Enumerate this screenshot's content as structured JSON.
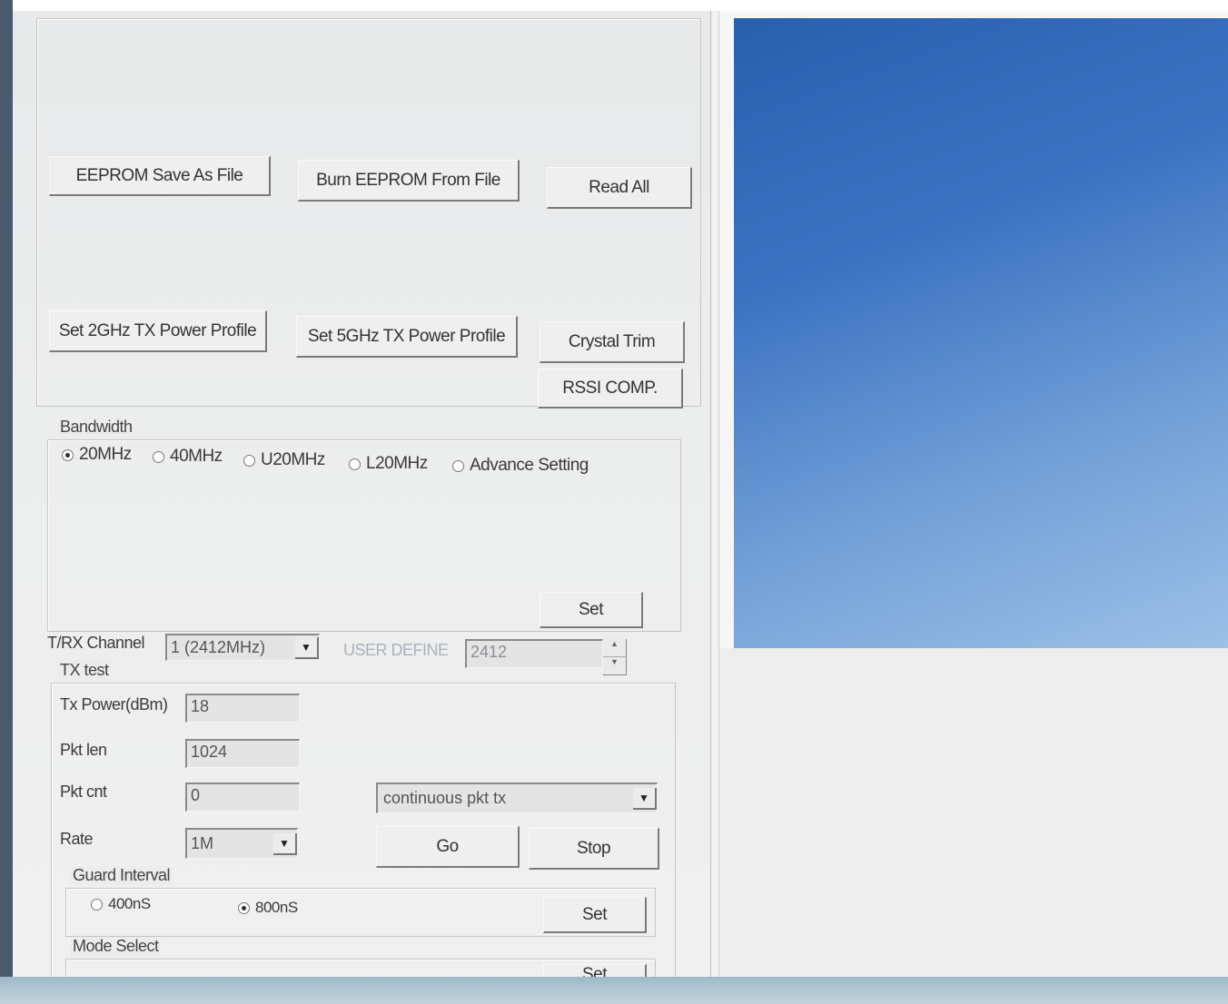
{
  "eeprom_buttons": {
    "save_as_file": "EEPROM Save As File",
    "burn_from_file": "Burn EEPROM From File",
    "read_all": "Read All"
  },
  "power_buttons": {
    "set_2ghz": "Set 2GHz TX Power Profile",
    "set_5ghz": "Set 5GHz TX Power Profile",
    "crystal_trim": "Crystal Trim",
    "rssi_comp": "RSSI COMP."
  },
  "bandwidth": {
    "title": "Bandwidth",
    "options": [
      "20MHz",
      "40MHz",
      "U20MHz",
      "L20MHz",
      "Advance Setting"
    ],
    "selected": "20MHz",
    "set_label": "Set"
  },
  "channel": {
    "label": "T/RX Channel",
    "value": "1 (2412MHz)",
    "user_define_label": "USER DEFINE",
    "user_define_value": "2412"
  },
  "tx_test": {
    "title": "TX test",
    "tx_power_label": "Tx Power(dBm)",
    "tx_power_value": "18",
    "pkt_len_label": "Pkt len",
    "pkt_len_value": "1024",
    "pkt_cnt_label": "Pkt cnt",
    "pkt_cnt_value": "0",
    "mode_value": "continuous pkt tx",
    "rate_label": "Rate",
    "rate_value": "1M",
    "go_label": "Go",
    "stop_label": "Stop"
  },
  "guard_interval": {
    "title": "Guard Interval",
    "options": [
      "400nS",
      "800nS"
    ],
    "selected": "800nS",
    "set_label": "Set"
  },
  "mode_select": {
    "title": "Mode Select",
    "set_label": "Set"
  },
  "colors": {
    "desktop_blue": "#3b73c2",
    "panel_bg": "#ececec"
  }
}
